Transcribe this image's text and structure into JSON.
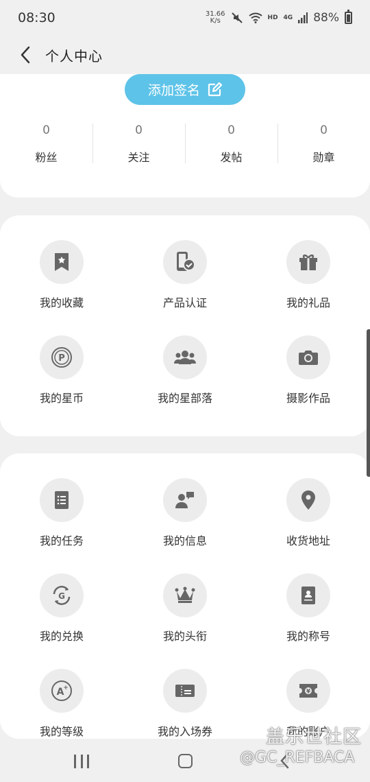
{
  "status_bar": {
    "time": "08:30",
    "net_speed_value": "31.66",
    "net_speed_unit": "K/s",
    "hd": "HD",
    "signal_type": "4G",
    "battery": "88%"
  },
  "header": {
    "title": "个人中心"
  },
  "profile": {
    "sign_button_label": "添加签名",
    "stats": [
      {
        "value": "0",
        "label": "粉丝"
      },
      {
        "value": "0",
        "label": "关注"
      },
      {
        "value": "0",
        "label": "发帖"
      },
      {
        "value": "0",
        "label": "勋章"
      }
    ]
  },
  "section1": {
    "items": [
      {
        "label": "我的收藏",
        "icon": "bookmark-icon"
      },
      {
        "label": "产品认证",
        "icon": "phone-verified-icon"
      },
      {
        "label": "我的礼品",
        "icon": "gift-icon"
      },
      {
        "label": "我的星币",
        "icon": "coin-icon"
      },
      {
        "label": "我的星部落",
        "icon": "group-icon"
      },
      {
        "label": "摄影作品",
        "icon": "camera-icon"
      }
    ]
  },
  "section2": {
    "items": [
      {
        "label": "我的任务",
        "icon": "task-list-icon"
      },
      {
        "label": "我的信息",
        "icon": "message-user-icon"
      },
      {
        "label": "收货地址",
        "icon": "location-pin-icon"
      },
      {
        "label": "我的兑换",
        "icon": "exchange-icon"
      },
      {
        "label": "我的头衔",
        "icon": "crown-icon"
      },
      {
        "label": "我的称号",
        "icon": "badge-card-icon"
      },
      {
        "label": "我的等级",
        "icon": "level-icon"
      },
      {
        "label": "我的入场券",
        "icon": "ticket-icon"
      },
      {
        "label": "我的账户",
        "icon": "wallet-icon"
      }
    ]
  },
  "watermark": {
    "line1": "盖乐世社区",
    "line2": "@GC_REFBACA"
  },
  "colors": {
    "accent": "#5ec3e8",
    "icon_bg": "#ececec",
    "icon_fg": "#666666",
    "page_bg": "#f0f0f0"
  }
}
